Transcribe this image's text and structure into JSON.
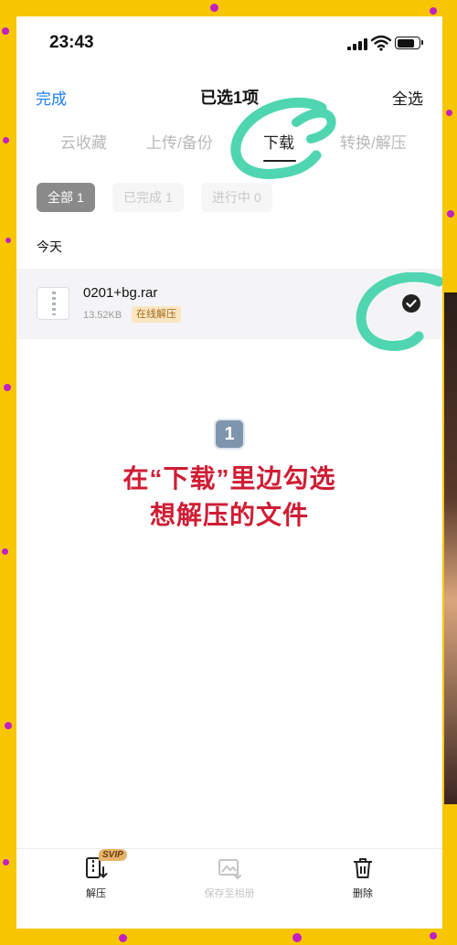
{
  "status_bar": {
    "time": "23:43"
  },
  "nav": {
    "done": "完成",
    "title": "已选1项",
    "select_all": "全选"
  },
  "tabs": [
    {
      "label": "云收藏"
    },
    {
      "label": "上传/备份"
    },
    {
      "label": "下载"
    },
    {
      "label": "转换/解压"
    }
  ],
  "filters": [
    {
      "label": "全部",
      "count": "1"
    },
    {
      "label": "已完成",
      "count": "1"
    },
    {
      "label": "进行中",
      "count": "0"
    }
  ],
  "section": {
    "label": "今天"
  },
  "file": {
    "name": "0201+bg.rar",
    "size": "13.52KB",
    "badge": "在线解压"
  },
  "instruction": {
    "number": "1",
    "line1": "在“下载”里边勾选",
    "line2": "想解压的文件"
  },
  "bottom_bar": {
    "extract": {
      "label": "解压",
      "badge": "SVIP"
    },
    "save_album": {
      "label": "保存至相册"
    },
    "delete": {
      "label": "删除"
    }
  },
  "colors": {
    "accent": "#1e7cf2",
    "instruction": "#cf1d34",
    "scribble": "#4fd6b0",
    "background": "#f7c600"
  },
  "icons": [
    "wifi-icon",
    "battery-icon",
    "zip-file-icon",
    "checkmark-icon",
    "extract-icon",
    "save-to-album-icon",
    "trash-icon"
  ]
}
